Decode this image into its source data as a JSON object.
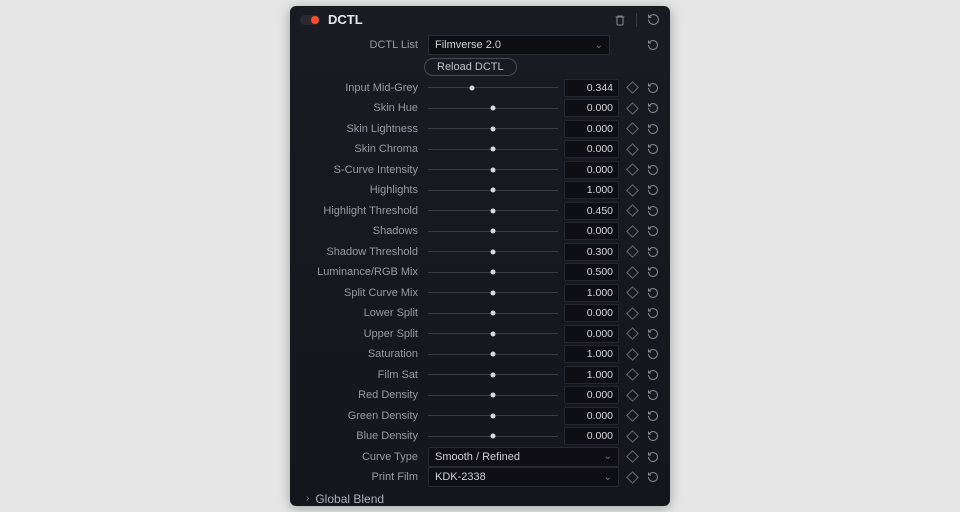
{
  "header": {
    "title": "DCTL"
  },
  "dctl_list": {
    "label": "DCTL List",
    "value": "Filmverse 2.0",
    "reload_label": "Reload DCTL"
  },
  "params": [
    {
      "label": "Input Mid-Grey",
      "value": "0.344",
      "pos": 34
    },
    {
      "label": "Skin Hue",
      "value": "0.000",
      "pos": 50
    },
    {
      "label": "Skin Lightness",
      "value": "0.000",
      "pos": 50
    },
    {
      "label": "Skin Chroma",
      "value": "0.000",
      "pos": 50
    },
    {
      "label": "S-Curve Intensity",
      "value": "0.000",
      "pos": 50
    },
    {
      "label": "Highlights",
      "value": "1.000",
      "pos": 50
    },
    {
      "label": "Highlight Threshold",
      "value": "0.450",
      "pos": 50
    },
    {
      "label": "Shadows",
      "value": "0.000",
      "pos": 50
    },
    {
      "label": "Shadow Threshold",
      "value": "0.300",
      "pos": 50
    },
    {
      "label": "Luminance/RGB Mix",
      "value": "0.500",
      "pos": 50
    },
    {
      "label": "Split Curve Mix",
      "value": "1.000",
      "pos": 50
    },
    {
      "label": "Lower Split",
      "value": "0.000",
      "pos": 50
    },
    {
      "label": "Upper Split",
      "value": "0.000",
      "pos": 50
    },
    {
      "label": "Saturation",
      "value": "1.000",
      "pos": 50
    },
    {
      "label": "Film Sat",
      "value": "1.000",
      "pos": 50
    },
    {
      "label": "Red Density",
      "value": "0.000",
      "pos": 50
    },
    {
      "label": "Green Density",
      "value": "0.000",
      "pos": 50
    },
    {
      "label": "Blue Density",
      "value": "0.000",
      "pos": 50
    }
  ],
  "curve_type": {
    "label": "Curve Type",
    "value": "Smooth / Refined"
  },
  "print_film": {
    "label": "Print Film",
    "value": "KDK-2338"
  },
  "group": {
    "label": "Global Blend"
  }
}
